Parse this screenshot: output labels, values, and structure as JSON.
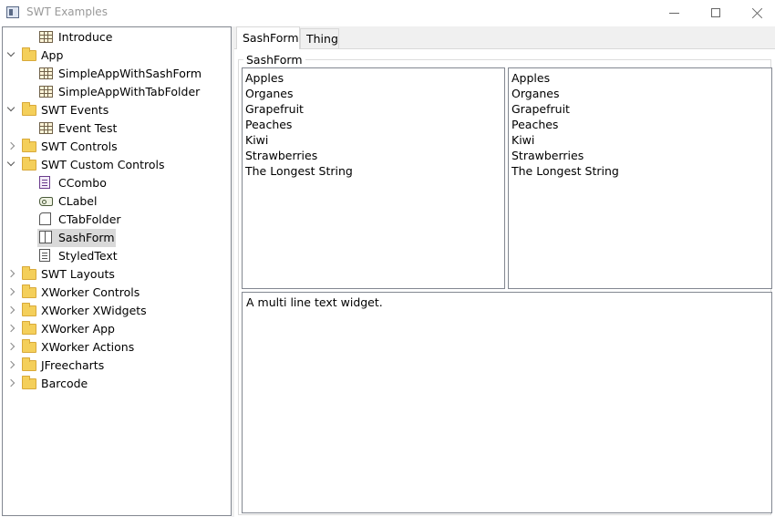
{
  "window": {
    "title": "SWT Examples"
  },
  "tree": {
    "items": [
      {
        "label": "Introduce",
        "level": 1,
        "icon": "table-icon",
        "toggle": "none"
      },
      {
        "label": "App",
        "level": 0,
        "icon": "folder-icon",
        "toggle": "expanded"
      },
      {
        "label": "SimpleAppWithSashForm",
        "level": 1,
        "icon": "table-icon",
        "toggle": "none"
      },
      {
        "label": "SimpleAppWithTabFolder",
        "level": 1,
        "icon": "table-icon",
        "toggle": "none"
      },
      {
        "label": "SWT Events",
        "level": 0,
        "icon": "folder-icon",
        "toggle": "expanded"
      },
      {
        "label": "Event Test",
        "level": 1,
        "icon": "table-icon",
        "toggle": "none"
      },
      {
        "label": "SWT Controls",
        "level": 0,
        "icon": "folder-icon",
        "toggle": "collapsed"
      },
      {
        "label": "SWT Custom Controls",
        "level": 0,
        "icon": "folder-icon",
        "toggle": "expanded"
      },
      {
        "label": "CCombo",
        "level": 1,
        "icon": "ccombo-icon",
        "toggle": "none"
      },
      {
        "label": "CLabel",
        "level": 1,
        "icon": "clabel-icon",
        "toggle": "none"
      },
      {
        "label": "CTabFolder",
        "level": 1,
        "icon": "ctabfolder-icon",
        "toggle": "none"
      },
      {
        "label": "SashForm",
        "level": 1,
        "icon": "sashform-icon",
        "toggle": "none",
        "selected": true
      },
      {
        "label": "StyledText",
        "level": 1,
        "icon": "styledtext-icon",
        "toggle": "none"
      },
      {
        "label": "SWT Layouts",
        "level": 0,
        "icon": "folder-icon",
        "toggle": "collapsed"
      },
      {
        "label": "XWorker Controls",
        "level": 0,
        "icon": "folder-icon",
        "toggle": "collapsed"
      },
      {
        "label": "XWorker XWidgets",
        "level": 0,
        "icon": "folder-icon",
        "toggle": "collapsed"
      },
      {
        "label": "XWorker App",
        "level": 0,
        "icon": "folder-icon",
        "toggle": "collapsed"
      },
      {
        "label": "XWorker Actions",
        "level": 0,
        "icon": "folder-icon",
        "toggle": "collapsed"
      },
      {
        "label": "JFreecharts",
        "level": 0,
        "icon": "folder-icon",
        "toggle": "collapsed"
      },
      {
        "label": "Barcode",
        "level": 0,
        "icon": "folder-icon",
        "toggle": "collapsed"
      }
    ]
  },
  "tabs": [
    {
      "label": "SashForm",
      "active": true
    },
    {
      "label": "Thing",
      "active": false
    }
  ],
  "group": {
    "title": "SashForm"
  },
  "left_list": {
    "items": [
      "Apples",
      "Organes",
      "Grapefruit",
      "Peaches",
      "Kiwi",
      "Strawberries",
      "The Longest String"
    ]
  },
  "right_list": {
    "items": [
      "Apples",
      "Organes",
      "Grapefruit",
      "Peaches",
      "Kiwi",
      "Strawberries",
      "The Longest String"
    ]
  },
  "textarea": {
    "value": "A multi line text widget."
  }
}
